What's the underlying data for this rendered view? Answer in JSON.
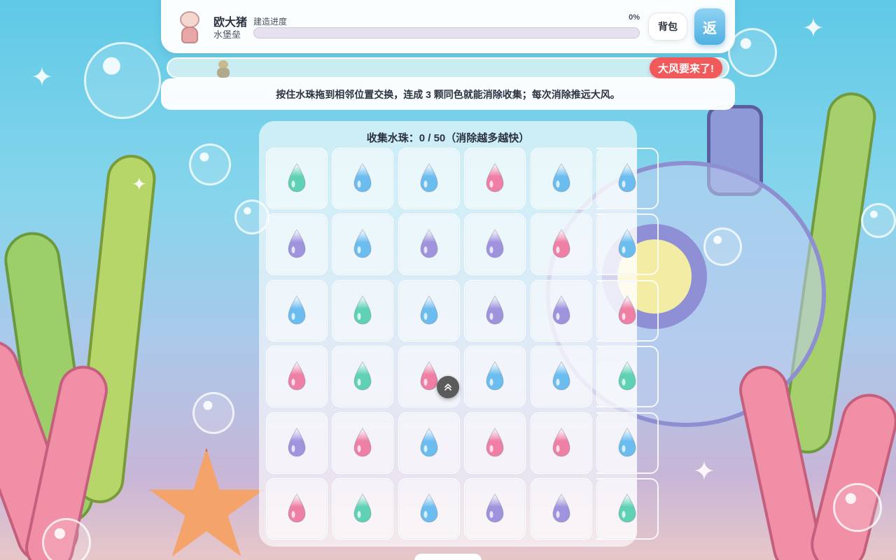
{
  "player": {
    "name": "欧大猪",
    "building": "水堡垒",
    "avatar_icon": "character-avatar-icon"
  },
  "progress": {
    "label": "建造进度",
    "percent_text": "0%",
    "value": 0
  },
  "buttons": {
    "bag": "背包",
    "back": "返"
  },
  "wind": {
    "warning": "大风要来了!"
  },
  "instruction": "按住水珠拖到相邻位置交换，连成 3 颗同色就能消除收集；每次消除推远大风。",
  "board": {
    "title": "收集水珠：0 / 50（消除越多越快）",
    "collected": 0,
    "target": 50,
    "colors": {
      "green": "#5fd1b5",
      "blue": "#6bbdf0",
      "pink": "#ef7fa5",
      "purple": "#9f93dd"
    },
    "grid": [
      [
        "green",
        "blue",
        "blue",
        "pink",
        "blue",
        "blue"
      ],
      [
        "purple",
        "blue",
        "purple",
        "purple",
        "pink",
        "blue"
      ],
      [
        "blue",
        "green",
        "blue",
        "purple",
        "purple",
        "pink"
      ],
      [
        "pink",
        "green",
        "pink",
        "blue",
        "blue",
        "green"
      ],
      [
        "purple",
        "pink",
        "blue",
        "pink",
        "pink",
        "blue"
      ],
      [
        "pink",
        "green",
        "blue",
        "purple",
        "purple",
        "green"
      ]
    ]
  },
  "scroll_top_icon": "chevron-double-up-icon"
}
